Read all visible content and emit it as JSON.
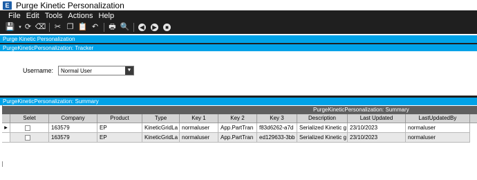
{
  "window": {
    "title": "Purge Kinetic Personalization",
    "app_icon": "E"
  },
  "menu": [
    "File",
    "Edit",
    "Tools",
    "Actions",
    "Help"
  ],
  "toolbar": {
    "icons": [
      "save-icon",
      "dropdown-arrow-icon",
      "refresh-icon",
      "clear-icon",
      "cut-icon",
      "copy-icon",
      "paste-icon",
      "undo-icon",
      "print-icon",
      "print-preview-icon",
      "back-icon",
      "forward-icon",
      "stop-icon"
    ],
    "glyphs": {
      "save": "💾",
      "dropdown": "▾",
      "refresh": "⟳",
      "clear": "⌫",
      "cut": "✂",
      "copy": "❐",
      "paste": "📋",
      "undo": "↶",
      "print": "🖶",
      "preview": "🔍",
      "back": "◀",
      "forward": "▶",
      "stop": "■"
    }
  },
  "panels": {
    "main": "Purge Kinetic Personalization",
    "tracker": "PurgeKineticPersonalization: Tracker",
    "summary": "PurgeKineticPersonalization: Summary"
  },
  "tracker": {
    "username_label": "Username:",
    "username_value": "Normal User"
  },
  "grid": {
    "caption": "PurgeKineticPersonalization: Summary",
    "columns": [
      "Selet",
      "Company",
      "Product",
      "Type",
      "Key 1",
      "Key 2",
      "Key 3",
      "Description",
      "Last Updated",
      "LastUpdatedBy"
    ],
    "current_row_marker": "▶",
    "rows": [
      {
        "company": "163579",
        "product": "EP",
        "type": "KineticGridLa",
        "key1": "normaluser",
        "key2": "App.PartTran",
        "key3": "f83d6262-a7d",
        "description": "Serialized Kinetic g",
        "last_updated": "23/10/2023",
        "last_updated_by": "normaluser"
      },
      {
        "company": "163579",
        "product": "EP",
        "type": "KineticGridLa",
        "key1": "normaluser",
        "key2": "App.PartTran",
        "key3": "ed129633-3bb",
        "description": "Serialized Kinetic g",
        "last_updated": "23/10/2023",
        "last_updated_by": "normaluser"
      }
    ]
  },
  "colors": {
    "accent": "#00a2e8",
    "menubar": "#1f1f1f",
    "grid_caption": "#5f5f5f",
    "header": "#d4d4d4"
  }
}
